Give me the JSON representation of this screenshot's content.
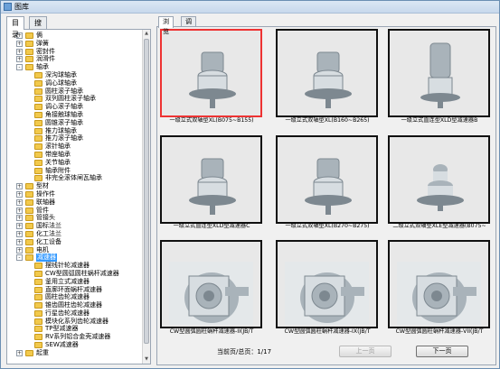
{
  "window": {
    "title": "图库"
  },
  "left_tabs": [
    {
      "label": "目录",
      "active": true
    },
    {
      "label": "搜索",
      "active": false
    }
  ],
  "tree": [
    {
      "label": "俩",
      "level": 0,
      "exp": "+"
    },
    {
      "label": "弹簧",
      "level": 0,
      "exp": "+"
    },
    {
      "label": "密封件",
      "level": 0,
      "exp": "+"
    },
    {
      "label": "润滑件",
      "level": 0,
      "exp": "+"
    },
    {
      "label": "轴承",
      "level": 0,
      "exp": "-"
    },
    {
      "label": "深沟球轴承",
      "level": 1
    },
    {
      "label": "调心球轴承",
      "level": 1
    },
    {
      "label": "圆柱滚子轴承",
      "level": 1
    },
    {
      "label": "双列圆柱滚子轴承",
      "level": 1
    },
    {
      "label": "调心滚子轴承",
      "level": 1
    },
    {
      "label": "角接触球轴承",
      "level": 1
    },
    {
      "label": "圆锥滚子轴承",
      "level": 1
    },
    {
      "label": "推力球轴承",
      "level": 1
    },
    {
      "label": "推力滚子轴承",
      "level": 1
    },
    {
      "label": "滚针轴承",
      "level": 1
    },
    {
      "label": "带座轴承",
      "level": 1
    },
    {
      "label": "关节轴承",
      "level": 1
    },
    {
      "label": "轴承附件",
      "level": 1
    },
    {
      "label": "非完全滚体闸瓦轴承",
      "level": 1
    },
    {
      "label": "型材",
      "level": 0,
      "exp": "+"
    },
    {
      "label": "操作件",
      "level": 0,
      "exp": "+"
    },
    {
      "label": "联轴器",
      "level": 0,
      "exp": "+"
    },
    {
      "label": "管件",
      "level": 0,
      "exp": "+"
    },
    {
      "label": "管接头",
      "level": 0,
      "exp": "+"
    },
    {
      "label": "国标法兰",
      "level": 0,
      "exp": "+"
    },
    {
      "label": "化工法兰",
      "level": 0,
      "exp": "+"
    },
    {
      "label": "化工设备",
      "level": 0,
      "exp": "+"
    },
    {
      "label": "电机",
      "level": 0,
      "exp": "+"
    },
    {
      "label": "减速器",
      "level": 0,
      "exp": "-",
      "selected": true
    },
    {
      "label": "摆线针轮减速器",
      "level": 1
    },
    {
      "label": "CW型圆弧圆柱蜗杆减速器",
      "level": 1
    },
    {
      "label": "釜用立式减速器",
      "level": 1
    },
    {
      "label": "直廓环面蜗杆减速器",
      "level": 1
    },
    {
      "label": "圆柱齿轮减速器",
      "level": 1
    },
    {
      "label": "锥齿圆柱齿轮减速器",
      "level": 1
    },
    {
      "label": "行星齿轮减速器",
      "level": 1
    },
    {
      "label": "模块化系列齿轮减速器",
      "level": 1
    },
    {
      "label": "TP型减速器",
      "level": 1
    },
    {
      "label": "RV系列铝合金壳减速器",
      "level": 1
    },
    {
      "label": "SEW减速器",
      "level": 1
    },
    {
      "label": "起重",
      "level": 0,
      "exp": "+"
    }
  ],
  "right_tabs": [
    {
      "label": "浏览",
      "active": true
    },
    {
      "label": "调用",
      "active": false
    }
  ],
  "items": [
    {
      "caption": "一级立式双轴型XL(B075~B155)",
      "model": "vertical-a",
      "selected": true
    },
    {
      "caption": "一级立式双轴型XL(B160~B265)",
      "model": "vertical-motor",
      "selected": false
    },
    {
      "caption": "一级立式直连型XLD型减速器B",
      "model": "tall-motor",
      "selected": false
    },
    {
      "caption": "一级立式直连型XLD型减速器C",
      "model": "vertical-b",
      "selected": false
    },
    {
      "caption": "一级立式双轴型XL(B270~B275)",
      "model": "vertical-c",
      "selected": false
    },
    {
      "caption": "二级立式双轴型XLE型减速器(B075~",
      "model": "stacked",
      "selected": false
    },
    {
      "caption": "CW型圆弧圆柱蜗杆减速器-II(JB/T",
      "model": "worm-a",
      "selected": false
    },
    {
      "caption": "CW型圆弧圆柱蜗杆减速器-IX(JB/T",
      "model": "worm-b",
      "selected": false
    },
    {
      "caption": "CW型圆弧圆柱蜗杆减速器-VII(JB/T",
      "model": "worm-c",
      "selected": false
    }
  ],
  "pager": {
    "status": "当前页/总页：1/17",
    "prev_label": "上一页",
    "next_label": "下一页",
    "prev_disabled": true
  }
}
